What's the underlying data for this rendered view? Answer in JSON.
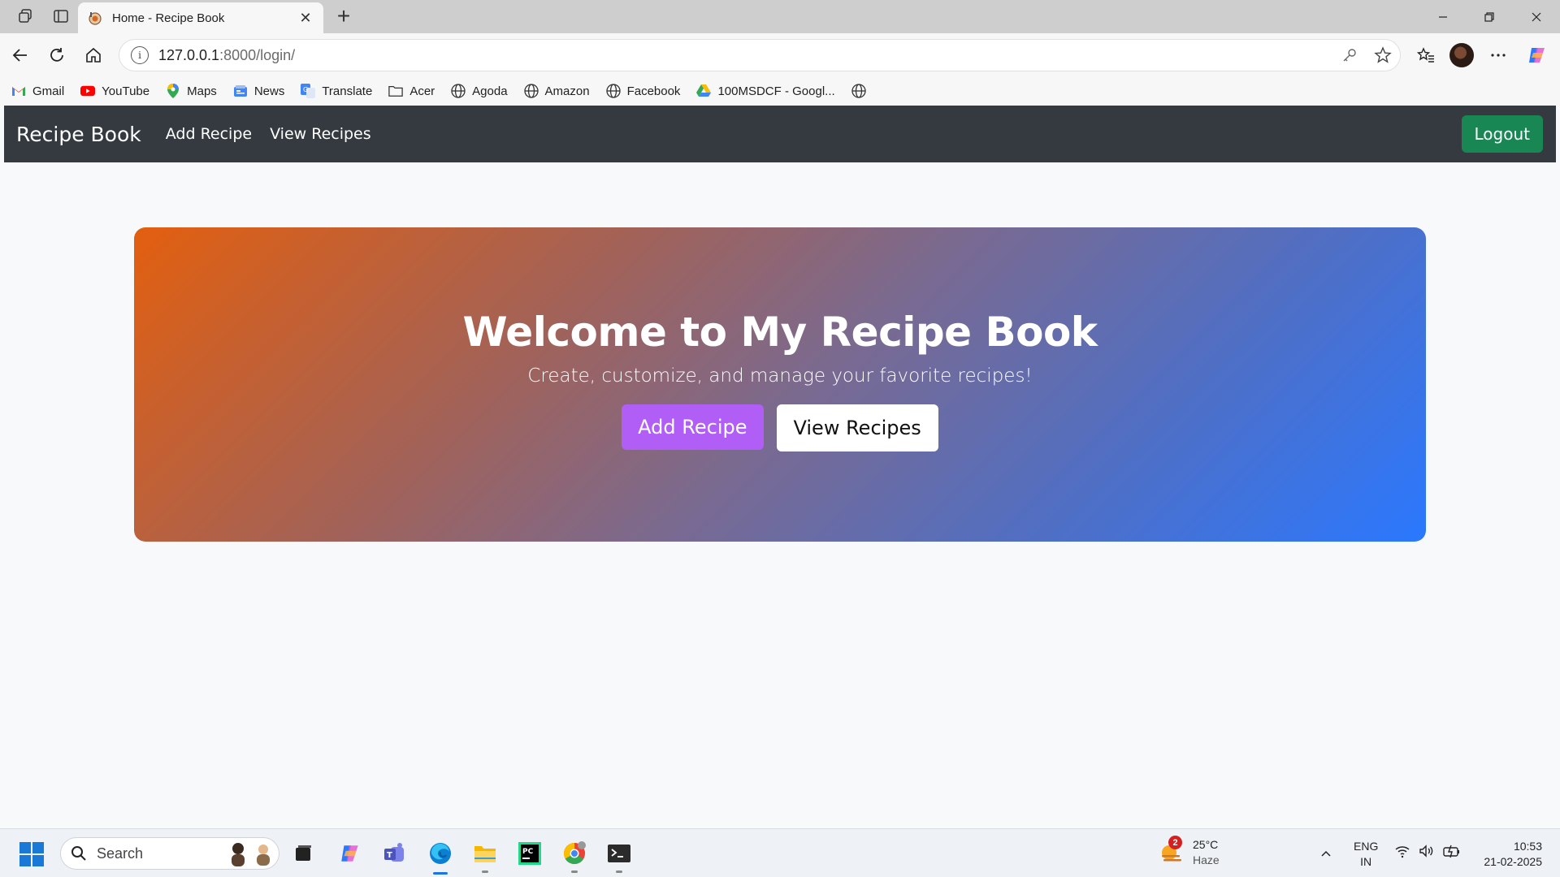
{
  "browser": {
    "tab_title": "Home - Recipe Book",
    "address_host": "127.0.0.1",
    "address_path": ":8000/login/"
  },
  "bookmarks": [
    {
      "label": "Gmail",
      "icon": "gmail-icon"
    },
    {
      "label": "YouTube",
      "icon": "youtube-icon"
    },
    {
      "label": "Maps",
      "icon": "maps-icon"
    },
    {
      "label": "News",
      "icon": "news-icon"
    },
    {
      "label": "Translate",
      "icon": "translate-icon"
    },
    {
      "label": "Acer",
      "icon": "folder-icon"
    },
    {
      "label": "Agoda",
      "icon": "globe-icon"
    },
    {
      "label": "Amazon",
      "icon": "globe-icon"
    },
    {
      "label": "Facebook",
      "icon": "globe-icon"
    },
    {
      "label": "100MSDCF - Googl...",
      "icon": "google-drive-icon"
    }
  ],
  "navbar": {
    "brand": "Recipe Book",
    "links": [
      "Add Recipe",
      "View Recipes"
    ],
    "logout": "Logout"
  },
  "hero": {
    "title": "Welcome to My Recipe Book",
    "subtitle": "Create, customize, and manage your favorite recipes!",
    "primary_button": "Add Recipe",
    "secondary_button": "View Recipes"
  },
  "taskbar": {
    "search_label": "Search",
    "weather_badge": "2",
    "weather_temp": "25°C",
    "weather_condition": "Haze",
    "lang_line1": "ENG",
    "lang_line2": "IN",
    "time": "10:53",
    "date": "21-02-2025"
  },
  "colors": {
    "navbar_bg": "#343a40",
    "logout_bg": "#198754",
    "hero_gradient_start": "#e35f0f",
    "hero_gradient_end": "#2a78ff",
    "primary_button_bg": "#b05ef5"
  }
}
